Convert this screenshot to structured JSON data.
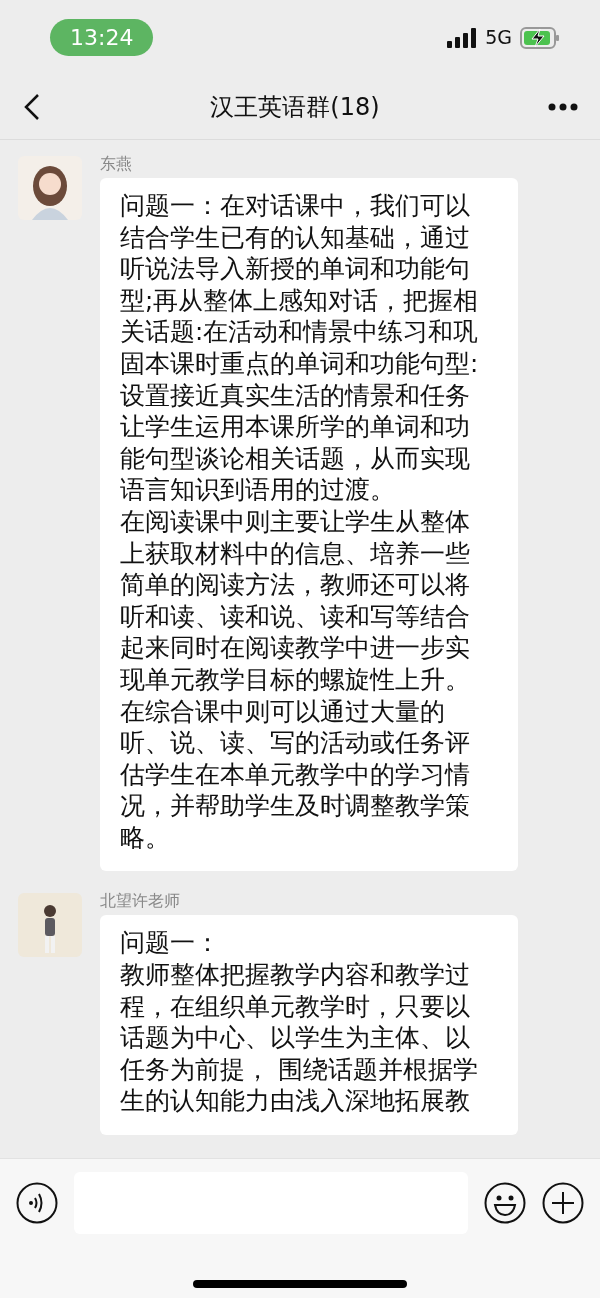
{
  "status_bar": {
    "time": "13:24",
    "network": "5G",
    "charging": true
  },
  "header": {
    "title": "汉王英语群(18)"
  },
  "messages": [
    {
      "sender": "东燕",
      "paragraphs": [
        "问题一：在对话课中，我们可以结合学生已有的认知基础，通过听说法导入新授的单词和功能句型;再从整体上感知对话，把握相关话题:在活动和情景中练习和巩固本课时重点的单词和功能句型:设置接近真实生活的情景和任务让学生运用本课所学的单词和功能句型谈论相关话题，从而实现语言知识到语用的过渡。",
        "在阅读课中则主要让学生从整体上获取材料中的信息、培养一些简单的阅读方法，教师还可以将听和读、读和说、读和写等结合起来同时在阅读教学中进一步实现单元教学目标的螺旋性上升。",
        "在综合课中则可以通过大量的听、说、读、写的活动或任务评估学生在本单元教学中的学习情况，并帮助学生及时调整教学策略。"
      ]
    },
    {
      "sender": "北望许老师",
      "paragraphs": [
        "问题一：",
        "教师整体把握教学内容和教学过程，在组织单元教学时，只要以话题为中心、以学生为主体、以任务为前提， 围绕话题并根据学生的认知能力由浅入深地拓展教"
      ]
    }
  ]
}
